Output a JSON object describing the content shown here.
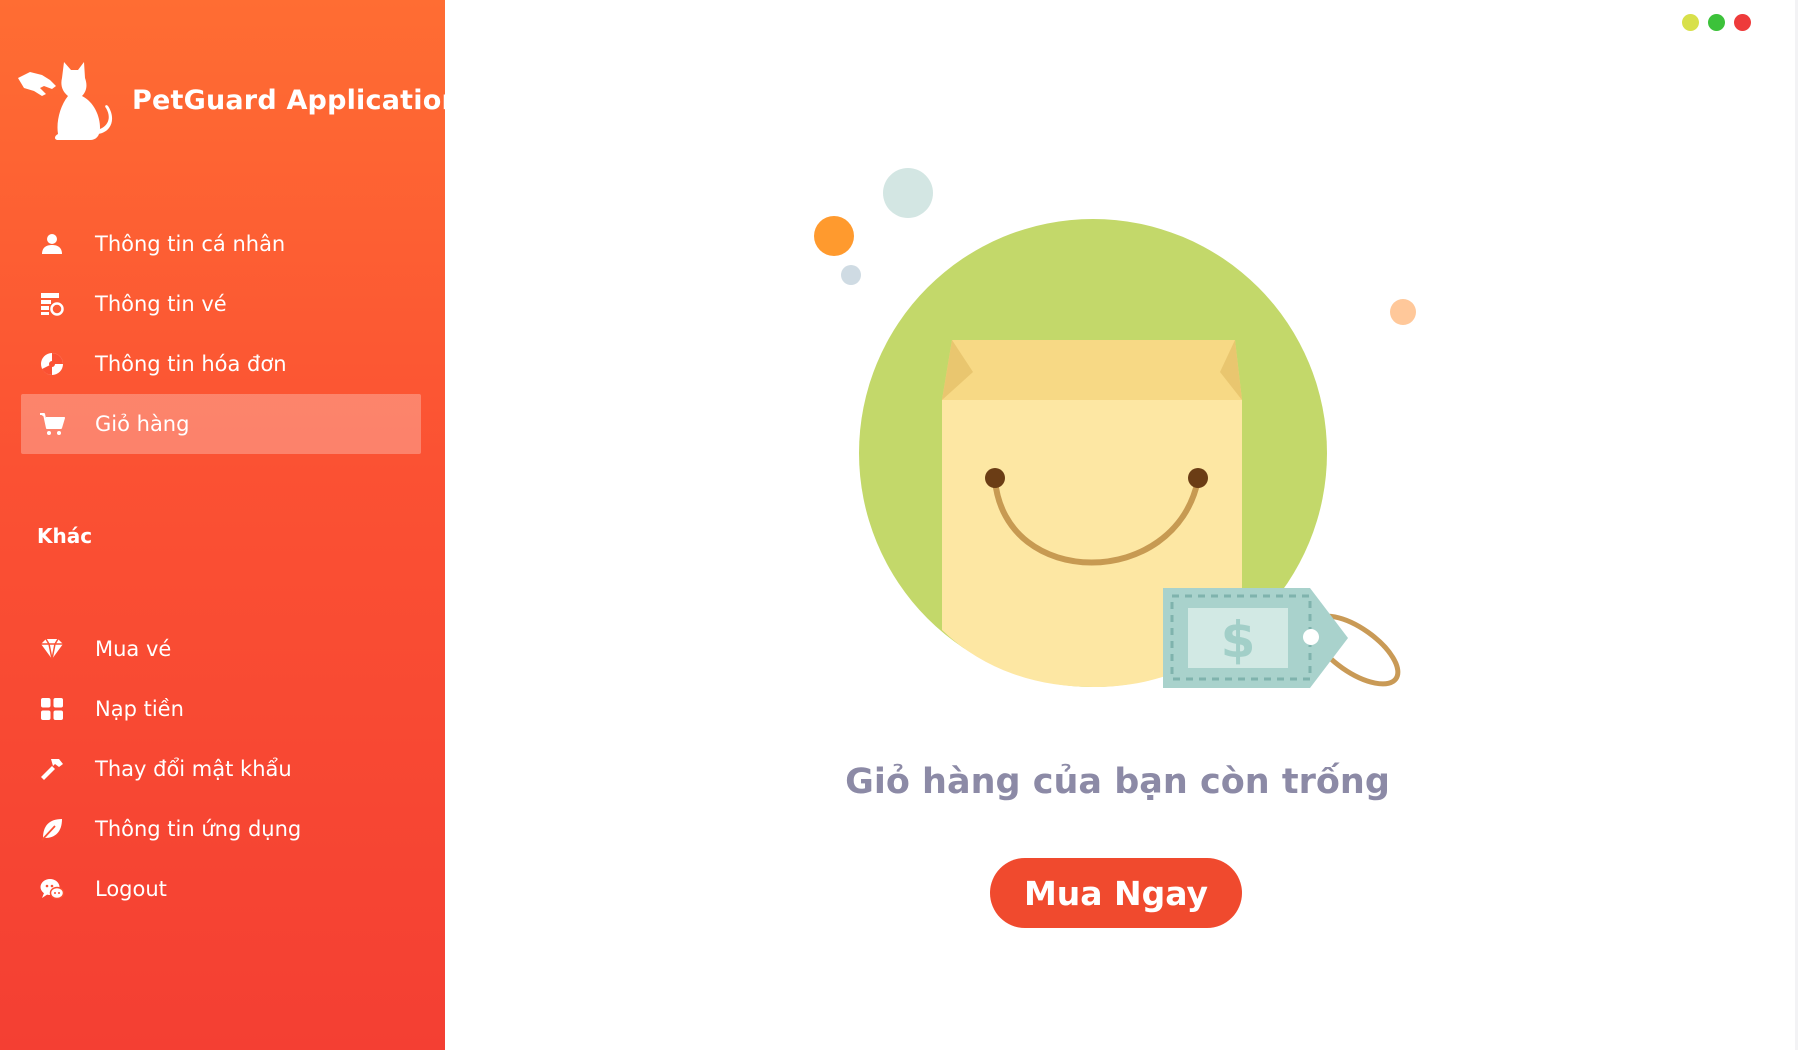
{
  "app": {
    "title": "PetGuard Application",
    "logo_icon": "cat-hand-logo-icon"
  },
  "sidebar": {
    "primary_items": [
      {
        "label": "Thông tin cá nhân",
        "icon": "user-icon",
        "active": false
      },
      {
        "label": "Thông tin vé",
        "icon": "ticket-info-icon",
        "active": false
      },
      {
        "label": "Thông tin hóa đơn",
        "icon": "invoice-icon",
        "active": false
      },
      {
        "label": "Giỏ hàng",
        "icon": "cart-icon",
        "active": true
      }
    ],
    "section_title": "Khác",
    "secondary_items": [
      {
        "label": "Mua vé",
        "icon": "diamond-icon"
      },
      {
        "label": "Nạp tiền",
        "icon": "grid-icon"
      },
      {
        "label": "Thay đổi mật khẩu",
        "icon": "hammer-icon"
      },
      {
        "label": "Thông tin ứng dụng",
        "icon": "leaf-icon"
      },
      {
        "label": "Logout",
        "icon": "chat-bubbles-icon"
      }
    ]
  },
  "window_controls": {
    "minimize_color": "#d8e04a",
    "maximize_color": "#3cc23a",
    "close_color": "#ee3b3b"
  },
  "main": {
    "empty_message": "Giỏ hàng của bạn còn trống",
    "buy_button_label": "Mua Ngay",
    "illustration": "empty-shopping-bag-illustration"
  },
  "colors": {
    "accent": "#f04a2e",
    "sidebar_top": "#ff6d33",
    "sidebar_bottom": "#f43f33",
    "empty_text": "#8c8aa6"
  }
}
